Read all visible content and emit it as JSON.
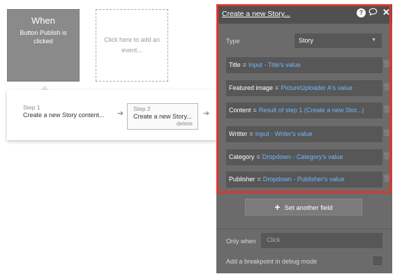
{
  "canvas": {
    "when_card": {
      "title": "When",
      "subtitle": "Button Publish is clicked"
    },
    "add_event": {
      "label": "Click here to add an event..."
    },
    "steps": [
      {
        "label": "Step 1",
        "title": "Create a new Story content..."
      },
      {
        "label": "Step 2",
        "title": "Create a new Story...",
        "delete_label": "delete"
      }
    ]
  },
  "panel": {
    "title": "Create a new Story...",
    "type_label": "Type",
    "type_value": "Story",
    "fields": [
      {
        "label": "Title",
        "eq": "=",
        "value": "Input - Title's value"
      },
      {
        "label": "Featured image",
        "eq": "=",
        "value": "PictureUploader A's value"
      },
      {
        "label": "Content",
        "eq": "=",
        "value": "Result of step 1 (Create a new Stor...)"
      },
      {
        "label": "Writter",
        "eq": "=",
        "value": "Input - Writer's value"
      },
      {
        "label": "Category",
        "eq": "=",
        "value": "Dropdown - Category's value"
      },
      {
        "label": "Publisher",
        "eq": "=",
        "value": "Dropdown - Publisher's value"
      }
    ],
    "set_another_label": "Set another field",
    "only_when_label": "Only when",
    "only_when_placeholder": "Click",
    "breakpoint_label": "Add a breakpoint in debug mode",
    "icons": {
      "help": "help-icon",
      "comment": "comment-icon",
      "close": "close-icon",
      "trash": "trash-icon",
      "plus": "plus-icon",
      "arrow": "arrow-right-icon",
      "caret": "caret-down-icon"
    },
    "colors": {
      "highlight": "#e0342c",
      "value_link": "#6fb8ff"
    }
  }
}
